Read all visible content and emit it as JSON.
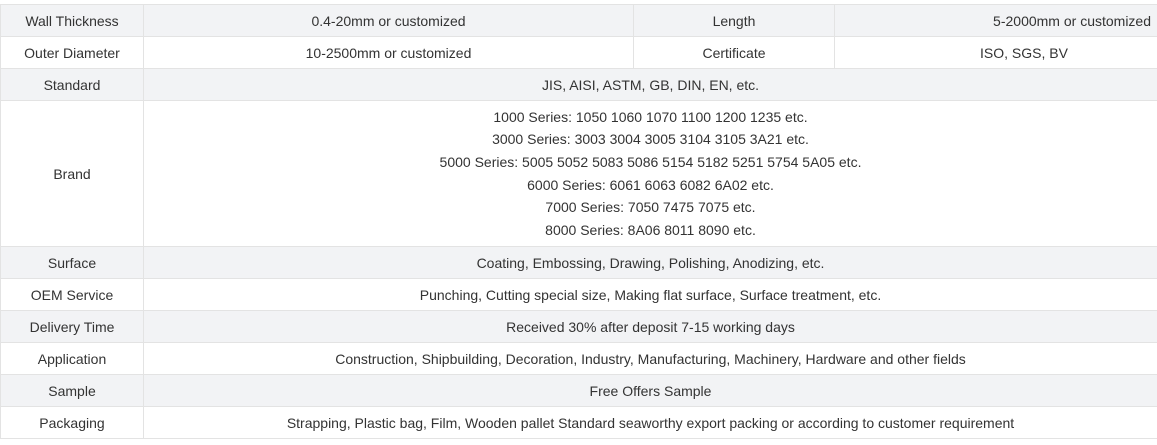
{
  "rows": [
    {
      "label": "Wall Thickness",
      "value": "0.4-20mm or customized",
      "label2": "Length",
      "value2": "5-2000mm or customized"
    },
    {
      "label": "Outer Diameter",
      "value": "10-2500mm or customized",
      "label2": "Certificate",
      "value2": "ISO, SGS, BV"
    },
    {
      "label": "Standard",
      "value": "JIS, AISI, ASTM, GB, DIN, EN, etc."
    },
    {
      "label": "Brand",
      "lines": [
        "1000 Series: 1050 1060 1070 1100 1200 1235 etc.",
        "3000 Series: 3003 3004 3005 3104 3105 3A21 etc.",
        "5000 Series: 5005 5052 5083 5086 5154 5182 5251 5754 5A05 etc.",
        "6000 Series: 6061 6063 6082 6A02 etc.",
        "7000 Series: 7050 7475 7075 etc.",
        "8000 Series: 8A06 8011 8090 etc."
      ]
    },
    {
      "label": "Surface",
      "value": "Coating, Embossing, Drawing, Polishing, Anodizing, etc."
    },
    {
      "label": "OEM Service",
      "value": "Punching, Cutting special size, Making flat surface, Surface treatment, etc."
    },
    {
      "label": "Delivery Time",
      "value": "Received 30% after deposit 7-15 working days"
    },
    {
      "label": "Application",
      "value": "Construction, Shipbuilding, Decoration, Industry, Manufacturing, Machinery, Hardware and other fields"
    },
    {
      "label": "Sample",
      "value": "Free Offers Sample"
    },
    {
      "label": "Packaging",
      "value": "Strapping, Plastic bag, Film, Wooden pallet Standard seaworthy export packing or according to customer requirement"
    }
  ]
}
